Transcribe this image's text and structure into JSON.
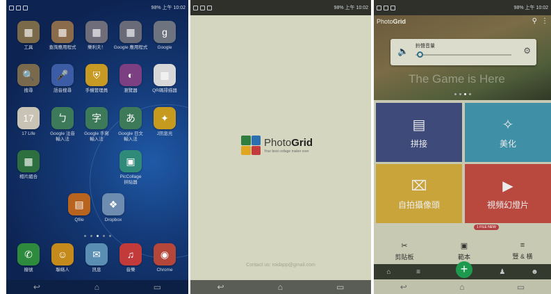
{
  "status": {
    "time_p1": "10:02",
    "time_p2": "10:02",
    "time_p3": "10:02",
    "battery": "98%",
    "ampm": "上午"
  },
  "home": {
    "apps": [
      {
        "label": "工具",
        "icon": "folder-icon",
        "color": "#7b6a4a",
        "glyph": "▦"
      },
      {
        "label": "查詢應用程式",
        "icon": "folder-icon",
        "color": "#8a6b4c",
        "glyph": "▦"
      },
      {
        "label": "樂利夫！",
        "icon": "folder-icon",
        "color": "#6f6d7a",
        "glyph": "▦"
      },
      {
        "label": "Google 應用程式",
        "icon": "folder-icon",
        "color": "#6a6b78",
        "glyph": "▦"
      },
      {
        "label": "Google",
        "icon": "google-icon",
        "color": "#6d7480",
        "glyph": "g"
      },
      {
        "label": "搜尋",
        "icon": "magnifier-icon",
        "color": "#7a6a4d",
        "glyph": "🔍"
      },
      {
        "label": "語音搜尋",
        "icon": "microphone-icon",
        "color": "#3d5ca6",
        "glyph": "🎤"
      },
      {
        "label": "手機管理員",
        "icon": "shield-icon",
        "color": "#c79a24",
        "glyph": "⛨"
      },
      {
        "label": "瀏覽器",
        "icon": "browser-icon",
        "color": "#7b3f82",
        "glyph": "◐"
      },
      {
        "label": "QR碼掃描器",
        "icon": "qr-icon",
        "color": "#d8d8d8",
        "glyph": "▦"
      },
      {
        "label": "17 Life",
        "icon": "17life-icon",
        "color": "#c9c3b5",
        "glyph": "17"
      },
      {
        "label": "Google 注音\n輸入法",
        "icon": "keyboard-icon",
        "color": "#3d7a5a",
        "glyph": "ㄅ"
      },
      {
        "label": "Google 手寫\n輸入法",
        "icon": "keyboard-icon",
        "color": "#3d7a5a",
        "glyph": "字"
      },
      {
        "label": "Google 日文\n輸入法",
        "icon": "keyboard-icon",
        "color": "#3d7a5a",
        "glyph": "あ"
      },
      {
        "label": "J訊息光",
        "icon": "flashlight-icon",
        "color": "#c59a1e",
        "glyph": "✦"
      },
      {
        "label": "相片組合",
        "icon": "photogrid-icon",
        "color": "#2e6f3f",
        "glyph": "▦"
      },
      {
        "label": "PicCollage\n拼貼器",
        "icon": "piccollage-icon",
        "color": "#2f8a79",
        "glyph": "▣"
      },
      {
        "label": "Qfile",
        "icon": "qfile-icon",
        "color": "#b8631e",
        "glyph": "▤"
      },
      {
        "label": "Dropbox",
        "icon": "dropbox-icon",
        "color": "#6d8cb0",
        "glyph": "❖"
      },
      {
        "label": "撥號",
        "icon": "phone-icon",
        "color": "#2e8a3d",
        "glyph": "✆"
      },
      {
        "label": "聯絡人",
        "icon": "contacts-icon",
        "color": "#c48a1b",
        "glyph": "☺"
      },
      {
        "label": "訊息",
        "icon": "messages-icon",
        "color": "#5a8fb3",
        "glyph": "✉"
      },
      {
        "label": "音樂",
        "icon": "music-icon",
        "color": "#c23a3a",
        "glyph": "♫"
      },
      {
        "label": "Chrome",
        "icon": "chrome-icon",
        "color": "#b5463a",
        "glyph": "◉"
      }
    ]
  },
  "splash": {
    "brand_thin": "Photo",
    "brand_bold": "Grid",
    "tagline": "Your best collage maker ever",
    "contact": "Contact us: roidapp@gmail.com"
  },
  "photogrid": {
    "title_thin": "Photo",
    "title_bold": "Grid",
    "hero_text": "The Game is Here",
    "volume_label": "鈴聲音量",
    "volume_level": 0.05,
    "tiles": [
      {
        "label": "拼接",
        "icon": "grid-icon",
        "color": "#3d4a7a",
        "glyph": "▤"
      },
      {
        "label": "美化",
        "icon": "magic-wand-icon",
        "color": "#3f8fa6",
        "glyph": "✧"
      },
      {
        "label": "自拍攝像頭",
        "icon": "camera-icon",
        "color": "#c9a43a",
        "glyph": "⌧"
      },
      {
        "label": "視頻幻燈片",
        "icon": "film-icon",
        "color": "#b9493f",
        "glyph": "▶"
      }
    ],
    "badge": "1 FILE NEW",
    "subitems": [
      {
        "label": "剪貼板",
        "icon": "scissors-icon",
        "glyph": "✂"
      },
      {
        "label": "範本",
        "icon": "template-icon",
        "glyph": "▣"
      },
      {
        "label": "豎 & 橫",
        "icon": "layout-icon",
        "glyph": "≡"
      }
    ]
  }
}
